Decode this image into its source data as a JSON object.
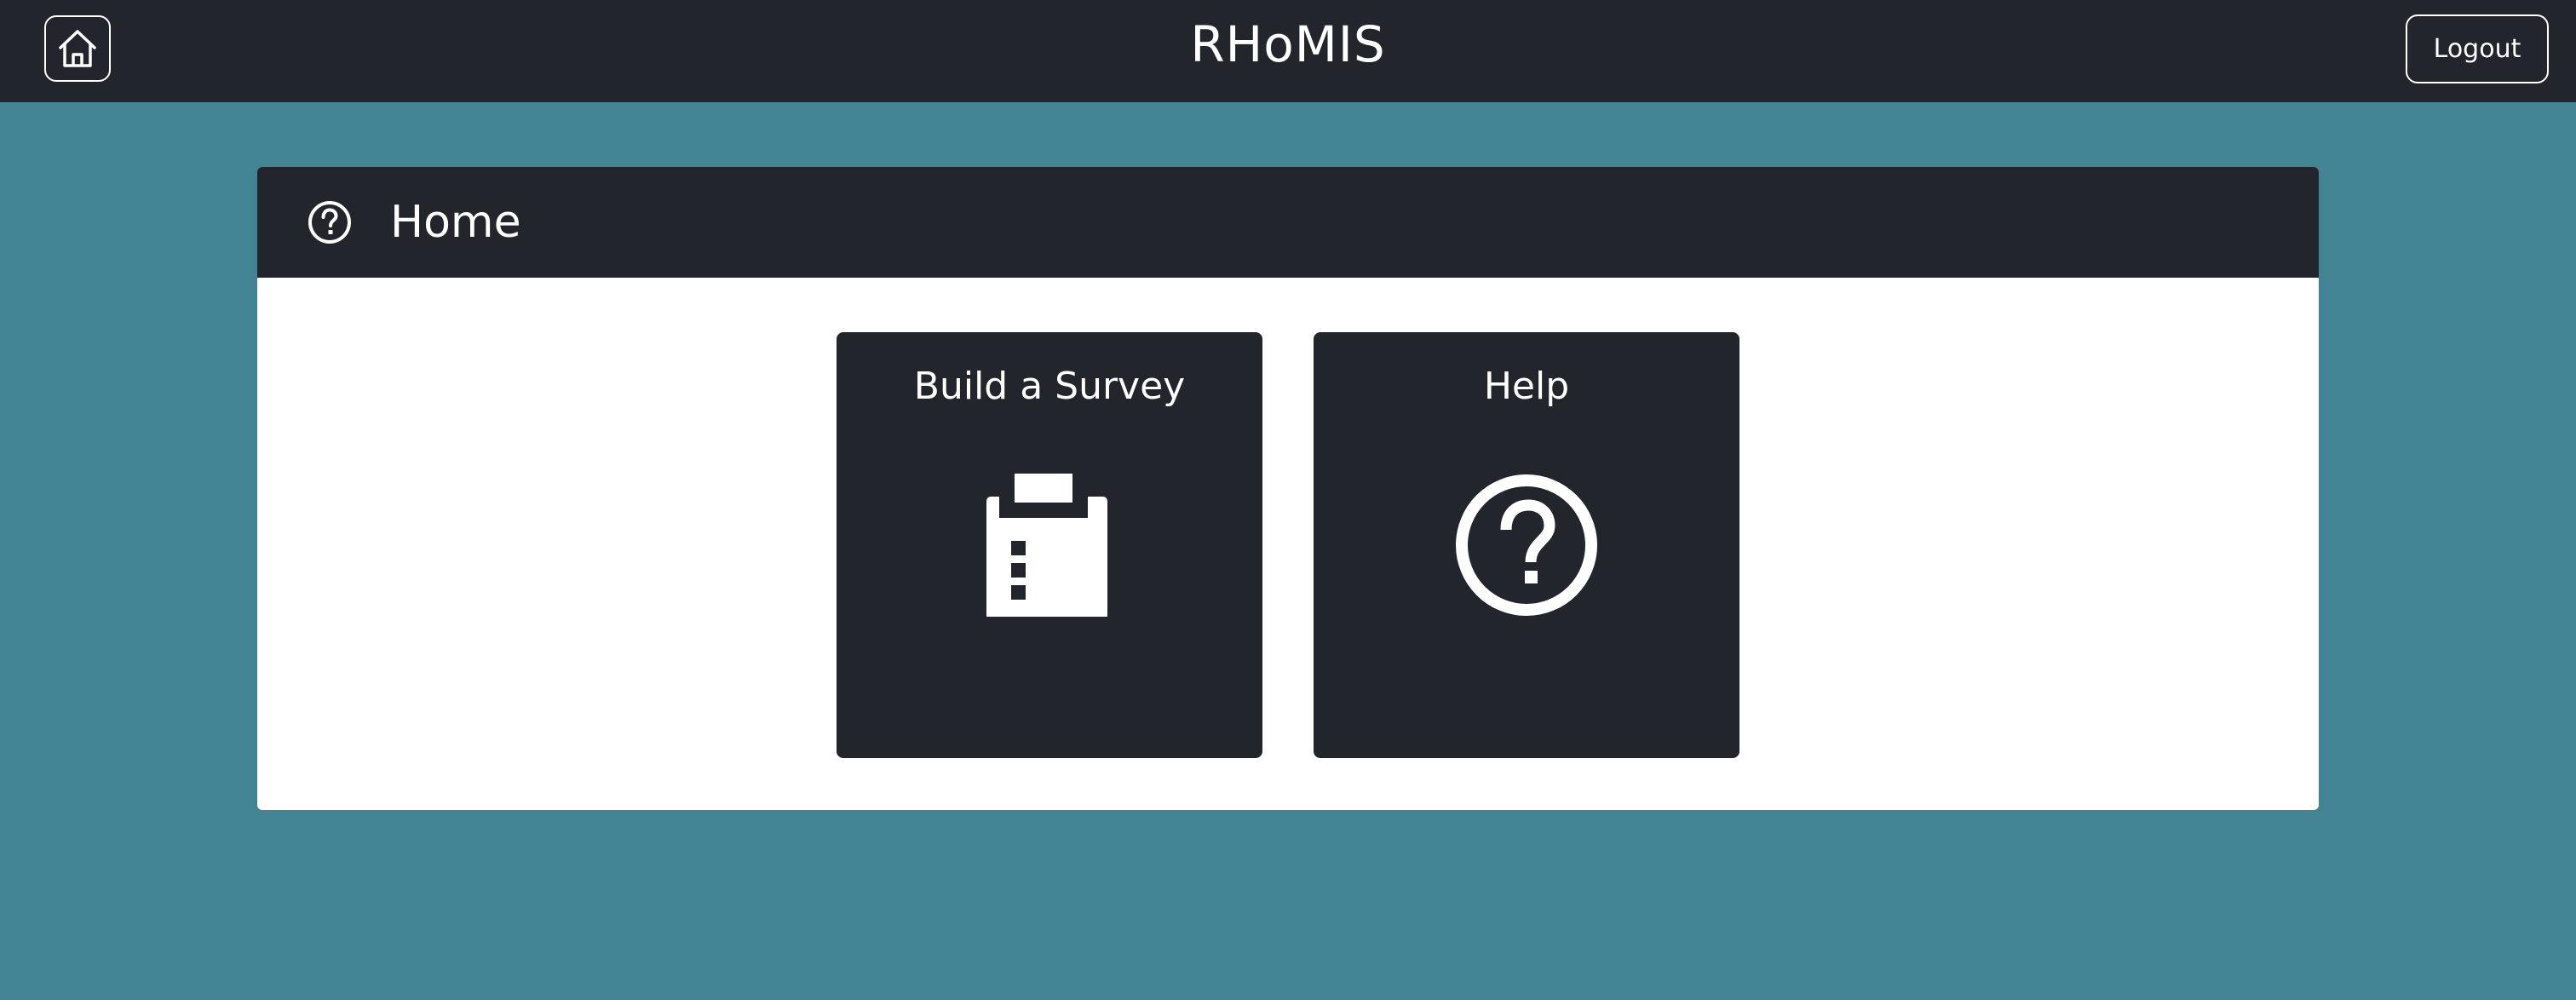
{
  "navbar": {
    "brand": "RHoMIS",
    "home_icon": "house-icon",
    "logout_label": "Logout"
  },
  "card": {
    "icon": "help-circle-icon",
    "title": "Home"
  },
  "tiles": [
    {
      "label": "Build a Survey",
      "icon": "clipboard-list-icon"
    },
    {
      "label": "Help",
      "icon": "help-circle-icon"
    }
  ],
  "colors": {
    "background": "#438494",
    "dark": "#22252b",
    "white": "#ffffff"
  }
}
